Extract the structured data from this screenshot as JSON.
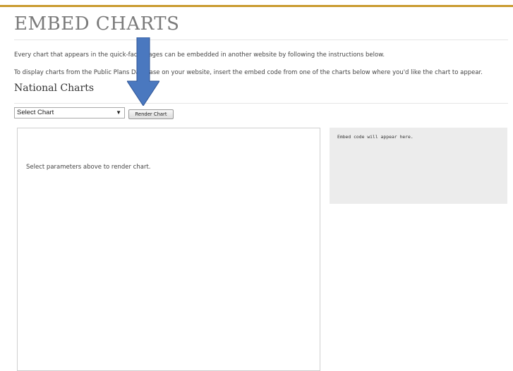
{
  "page": {
    "title": "EMBED CHARTS",
    "intro_line_1": "Every chart that appears in the quick-facts pages can be embedded in another website by following the instructions below.",
    "intro_line_2": "To display charts from the Public Plans Database on your website, insert the embed code from one of the charts below where you'd like the chart to appear."
  },
  "section": {
    "title": "National Charts"
  },
  "controls": {
    "select_value": "Select Chart",
    "render_label": "Render Chart"
  },
  "chart": {
    "placeholder": "Select parameters above to render chart."
  },
  "embed": {
    "text": "Embed code will appear here."
  },
  "colors": {
    "accent": "#c99a2e",
    "arrow": "#4a78bf"
  },
  "icons": {
    "caret": "chevron-down-icon",
    "annotation": "down-arrow-icon"
  }
}
